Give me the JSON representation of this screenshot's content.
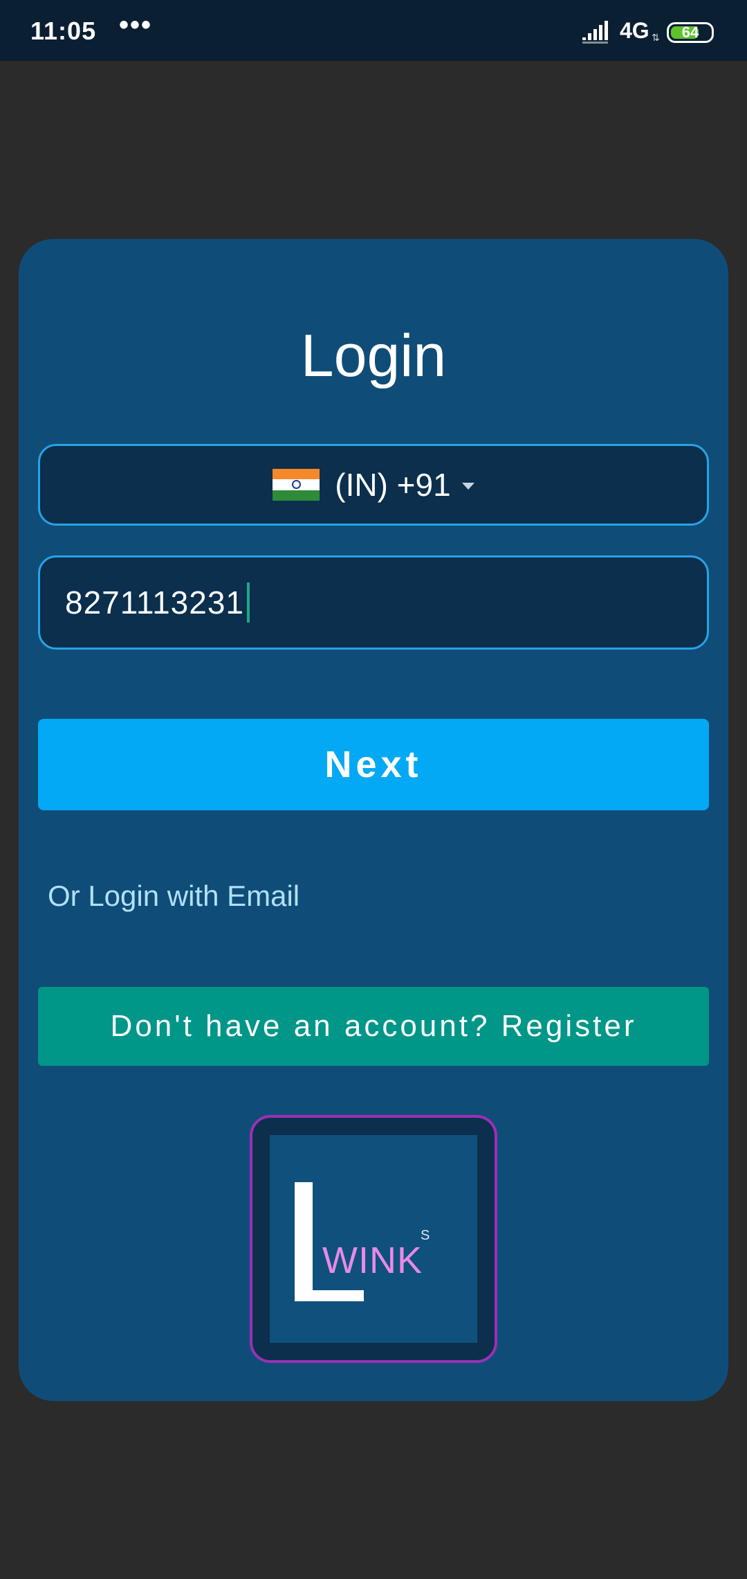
{
  "status_bar": {
    "time": "11:05",
    "dots": "•••",
    "network": "4G",
    "battery": "64",
    "icons": [
      "signal-icon",
      "battery-icon"
    ]
  },
  "login": {
    "title": "Login",
    "country": {
      "code": "(IN) +91",
      "flag": "india-flag-icon"
    },
    "phone": {
      "value": "8271113231"
    },
    "next_label": "Next",
    "email_link": "Or Login with Email",
    "register_label": "Don't have an account? Register"
  },
  "logo": {
    "letter": "L",
    "wink": "WINK",
    "superscript": "S"
  },
  "colors": {
    "background": "#2b2b2b",
    "status_bar": "#0b1f33",
    "card": "#0f4d78",
    "field": "#0b2f4c",
    "field_border": "#27a3e6",
    "next_button": "#03a9f4",
    "register_button": "#009688",
    "link": "#b3e0f7",
    "logo_border": "#9c2fb5",
    "logo_wink": "#e88ae6"
  }
}
